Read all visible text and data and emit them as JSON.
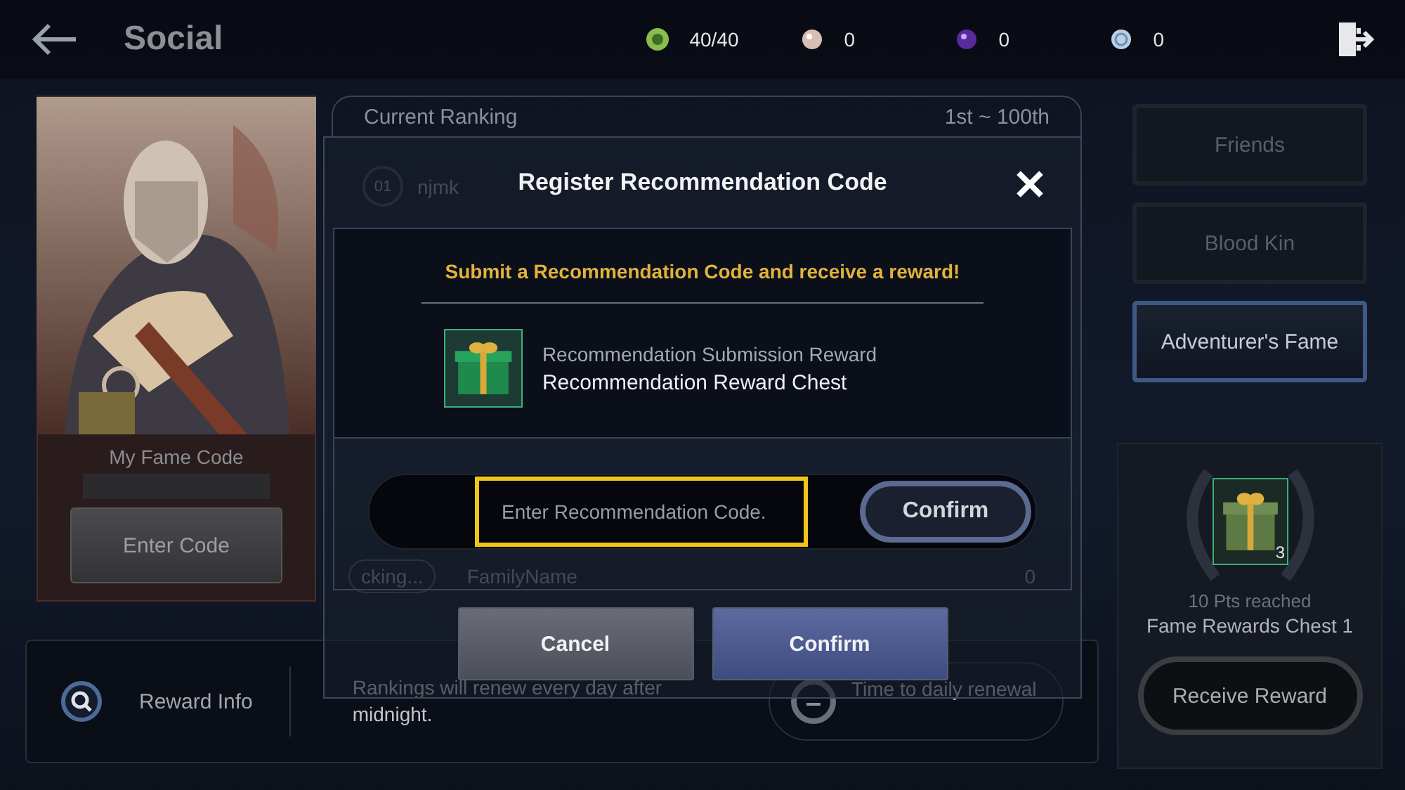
{
  "header": {
    "title": "Social",
    "currencies": [
      {
        "kind": "stamina",
        "value": "40/40"
      },
      {
        "kind": "pearl",
        "value": "0"
      },
      {
        "kind": "orb",
        "value": "0"
      },
      {
        "kind": "silver",
        "value": "0"
      }
    ]
  },
  "profile": {
    "fame_code_label": "My Fame Code",
    "enter_code_button": "Enter Code"
  },
  "ranking": {
    "title": "Current Ranking",
    "range": "1st ~ 100th",
    "rows": [
      {
        "rank": "01",
        "name": "njmk"
      }
    ],
    "my_row": {
      "rank": "cking...",
      "name": "FamilyName",
      "score": "0"
    }
  },
  "tabs": [
    {
      "label": "Friends",
      "selected": false
    },
    {
      "label": "Blood Kin",
      "selected": false
    },
    {
      "label": "Adventurer's Fame",
      "selected": true
    }
  ],
  "reward": {
    "count": "3",
    "caption": "10 Pts reached",
    "name": "Fame Rewards Chest 1",
    "button": "Receive Reward"
  },
  "footer": {
    "reward_info": "Reward Info",
    "notice": "Rankings will renew every day after midnight.",
    "timer_label": "Time to daily renewal"
  },
  "dialog": {
    "title": "Register Recommendation Code",
    "prompt": "Submit a Recommendation Code and receive a reward!",
    "reward_caption": "Recommendation Submission Reward",
    "reward_name": "Recommendation Reward Chest",
    "code_field": {
      "placeholder": "Enter Recommendation Code.",
      "highlighted": true
    },
    "field_button": "Confirm",
    "buttons": [
      {
        "label": "Cancel",
        "kind": "secondary"
      },
      {
        "label": "Confirm",
        "kind": "primary"
      }
    ]
  }
}
